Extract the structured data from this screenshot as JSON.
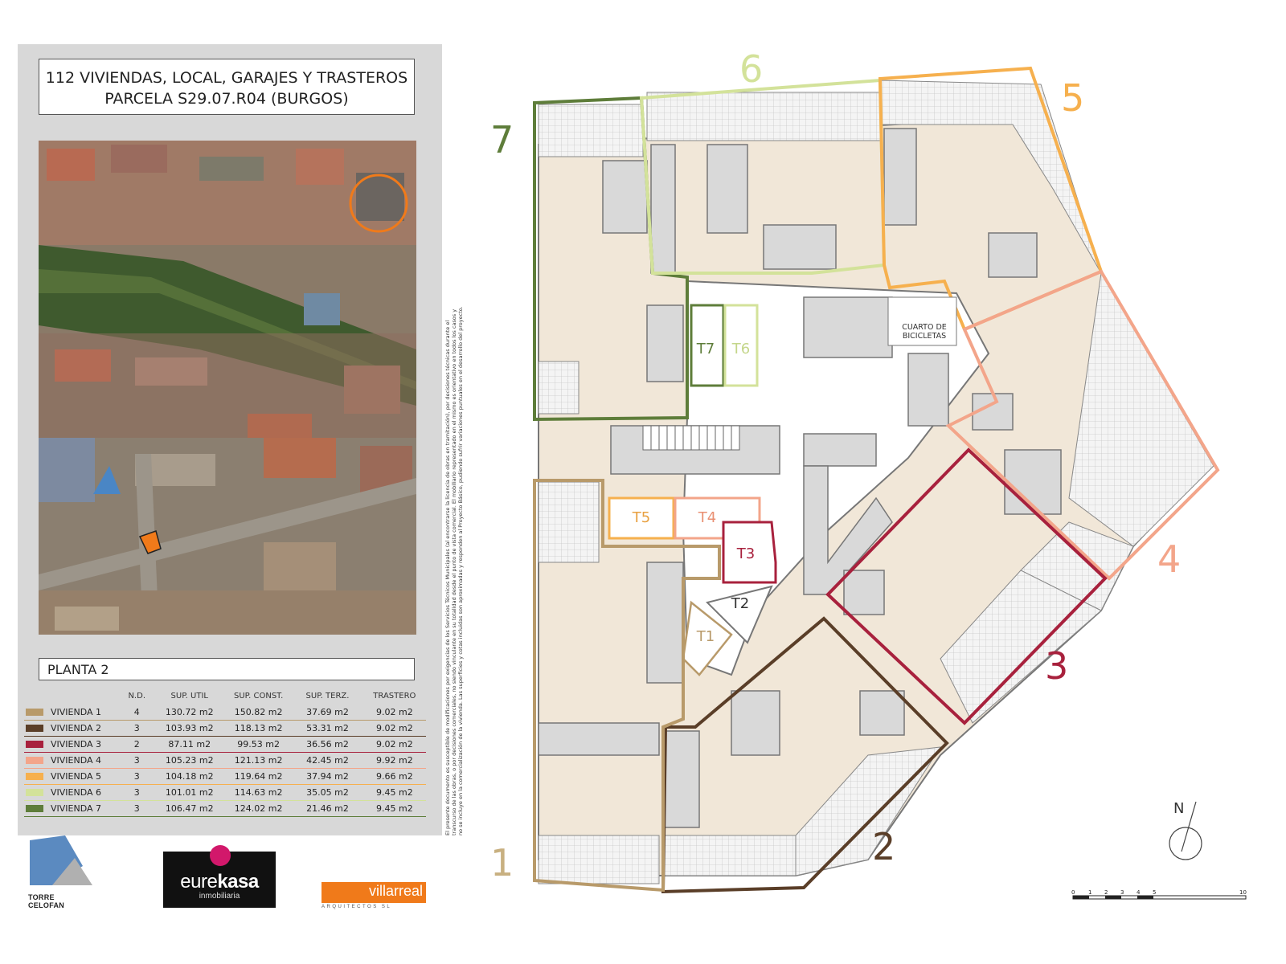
{
  "header": {
    "title_line1": "112 VIVIENDAS, LOCAL, GARAJES Y TRASTEROS",
    "title_line2": "PARCELA S29.07.R04 (BURGOS)"
  },
  "plant_label": "PLANTA 2",
  "table": {
    "columns": [
      "N.D.",
      "SUP. UTIL",
      "SUP. CONST.",
      "SUP. TERZ.",
      "TRASTERO"
    ],
    "rows": [
      {
        "name": "VIVIENDA 1",
        "nd": "4",
        "util": "130.72 m2",
        "const": "150.82 m2",
        "terz": "37.69 m2",
        "trastero": "9.02 m2",
        "color": "#b89a6a"
      },
      {
        "name": "VIVIENDA 2",
        "nd": "3",
        "util": "103.93 m2",
        "const": "118.13 m2",
        "terz": "53.31 m2",
        "trastero": "9.02 m2",
        "color": "#5a3e28"
      },
      {
        "name": "VIVIENDA 3",
        "nd": "2",
        "util": "87.11 m2",
        "const": "99.53 m2",
        "terz": "36.56 m2",
        "trastero": "9.02 m2",
        "color": "#a8213d"
      },
      {
        "name": "VIVIENDA 4",
        "nd": "3",
        "util": "105.23 m2",
        "const": "121.13 m2",
        "terz": "42.45 m2",
        "trastero": "9.92 m2",
        "color": "#f3a58a"
      },
      {
        "name": "VIVIENDA 5",
        "nd": "3",
        "util": "104.18 m2",
        "const": "119.64 m2",
        "terz": "37.94 m2",
        "trastero": "9.66 m2",
        "color": "#f6b04e"
      },
      {
        "name": "VIVIENDA 6",
        "nd": "3",
        "util": "101.01 m2",
        "const": "114.63 m2",
        "terz": "35.05 m2",
        "trastero": "9.45 m2",
        "color": "#d3e29a"
      },
      {
        "name": "VIVIENDA 7",
        "nd": "3",
        "util": "106.47 m2",
        "const": "124.02 m2",
        "terz": "21.46 m2",
        "trastero": "9.45 m2",
        "color": "#5e7d3a"
      }
    ]
  },
  "disclaimer": "El presente documento es susceptible de modificaciones por exigencias de los Servicios Técnicos Municipales (al encontrarse la licencia de obras en tramitación), por decisiones técnicas durante el transcurso de las obras, o por decisiones comerciales, no siendo vinculante en su totalidad desde el punto de vista comercial. El mobiliario representado en el mismo es orientativo en todos los casos y no se incluye en la comercialización de la vivienda. Las superficies y cotas incluidas son aproximadas y responden al Proyecto Básico, pudiendo sufrir variaciones puntuales en el desarrollo del proyecto.",
  "logos": {
    "torre": "TORRE CELOFAN",
    "eurekasa_a": "eure",
    "eurekasa_b": "kasa",
    "eurekasa_sub": "inmobiliaria",
    "villarreal": "villarreal",
    "villarreal_sub": "ARQUITECTOS SL"
  },
  "plan": {
    "unit_numbers": [
      "1",
      "2",
      "3",
      "4",
      "5",
      "6",
      "7"
    ],
    "storage_labels": [
      "T1",
      "T2",
      "T3",
      "T4",
      "T5",
      "T6",
      "T7"
    ],
    "bike_room_line1": "CUARTO DE",
    "bike_room_line2": "BICICLETAS",
    "north": "N",
    "scale_ticks": [
      "0",
      "1",
      "2",
      "3",
      "4",
      "5",
      "10"
    ]
  }
}
